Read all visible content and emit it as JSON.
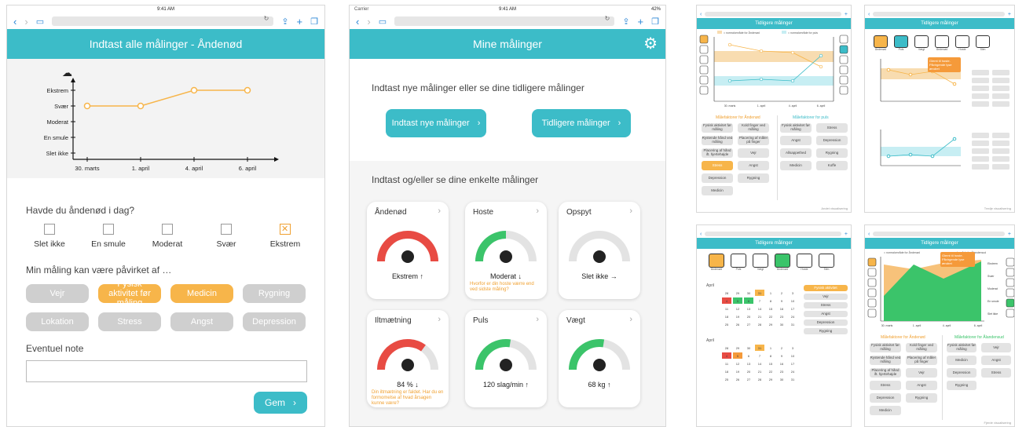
{
  "browser": {
    "time": "9:41 AM",
    "battery": "42%",
    "carrier": "Carrier"
  },
  "screen1": {
    "title": "Indtast alle målinger - Åndenød",
    "chart_data": {
      "type": "line",
      "categories": [
        "30. marts",
        "1. april",
        "4. april",
        "6. april"
      ],
      "y_levels": [
        "Slet ikke",
        "En smule",
        "Moderat",
        "Svær",
        "Ekstrem"
      ],
      "values": [
        3,
        3,
        4,
        4
      ],
      "color": "#f7b54a"
    },
    "question": "Havde du åndenød i dag?",
    "options": [
      "Slet ikke",
      "En smule",
      "Moderat",
      "Svær",
      "Ekstrem"
    ],
    "selected_option": "Ekstrem",
    "influence_label": "Min måling kan være påvirket af …",
    "tags": [
      {
        "label": "Vejr",
        "active": false
      },
      {
        "label": "Fysisk aktivitet før måling",
        "active": true
      },
      {
        "label": "Medicin",
        "active": true
      },
      {
        "label": "Rygning",
        "active": false
      },
      {
        "label": "Lokation",
        "active": false
      },
      {
        "label": "Stress",
        "active": false
      },
      {
        "label": "Angst",
        "active": false
      },
      {
        "label": "Depression",
        "active": false
      }
    ],
    "note_label": "Eventuel note",
    "save_label": "Gem",
    "save_arrow": "›"
  },
  "screen2": {
    "title": "Mine målinger",
    "intro": "Indtast nye målinger eller se dine tidligere målinger",
    "btn_new": "Indtast nye målinger",
    "btn_prev": "Tidligere målinger",
    "section": "Indtast og/eller se dine enkelte målinger",
    "cards": [
      {
        "title": "Åndenød",
        "value": "Ekstrem ↑",
        "warn": "",
        "level": 1.0,
        "color": "#e84b43"
      },
      {
        "title": "Hoste",
        "value": "Moderat ↓",
        "warn": "Hvorfor er din hoste værre end ved sidste måling?",
        "level": 0.5,
        "color": "#3bc46a"
      },
      {
        "title": "Opspyt",
        "value": "Slet ikke →",
        "warn": "",
        "level": 0.0,
        "color": "#3bc46a"
      },
      {
        "title": "Iltmætning",
        "value": "84 % ↓",
        "warn": "Din iltmætning er faldet. Har du en formomelse af hvad årsagen kunne være?",
        "level": 0.7,
        "color": "#e84b43"
      },
      {
        "title": "Puls",
        "value": "120 slag/min ↑",
        "warn": "",
        "level": 0.55,
        "color": "#3bc46a"
      },
      {
        "title": "Vægt",
        "value": "68 kg ↑",
        "warn": "",
        "level": 0.55,
        "color": "#3bc46a"
      }
    ]
  },
  "screen3": {
    "title": "Tidligere målinger",
    "legend1": "= normalområde for Åndenød",
    "legend2": "= normalområde for puls",
    "dates": [
      "30. marts",
      "1. april",
      "4. april",
      "6. april"
    ],
    "panel1": "Målefaktorer for Åndenød",
    "panel2": "Målefaktorer for puls",
    "factors1": [
      "Fysisk aktivitet før måling",
      "Kold finger ved måling",
      "Rystende hånd ved måling",
      "Placering af måler på finger",
      "Placering af hånd ift. hjertehøjde",
      "Vejr",
      "Stress",
      "Angst",
      "Depression",
      "Rygning",
      "Medicin"
    ],
    "factors2": [
      "Fysisk aktivitet før måling",
      "Stress",
      "Angst",
      "Depression",
      "Allsappethed",
      "Rygning",
      "Medicin",
      "Koffe"
    ],
    "footer": "Andet visualisering"
  },
  "screen4": {
    "title": "Tidligere målinger",
    "tiles": [
      "Åndenød",
      "Puls",
      "Vægt",
      "Åndenød",
      "Hoste",
      "Slim"
    ],
    "tooltip": "Glemt til hoste. Påvirgende lyse ændret",
    "footer": "Tredje visualisering"
  },
  "screen5": {
    "title": "Tidligere målinger",
    "tiles": [
      "Åndenød",
      "Puls",
      "Vægt",
      "Åndenød",
      "Hoste",
      "Slim"
    ],
    "month1": "April",
    "month2": "April",
    "weekdays": [
      "M",
      "T",
      "O",
      "T",
      "F",
      "L",
      "S"
    ]
  },
  "screen6": {
    "title": "Tidligere målinger",
    "legend1": "= normalområde for Åndenød",
    "legend2": "= normalområde for Ålandensud",
    "tooltip": "Glemt til hoste. Påvirgende lyse ændret",
    "y_levels": [
      "Ekstrem",
      "Svær",
      "Moderat",
      "En smule",
      "Slet ikke"
    ],
    "dates": [
      "30. marts",
      "1. april",
      "4. april",
      "6. april"
    ],
    "panel1": "Målefaktorer for Åndenød",
    "panel2": "Målefaktorer for Ålandensud",
    "factors1": [
      "Fysisk aktivitet før måling",
      "Kold finger ved måling",
      "Rystende hånd ved måling",
      "Placering af måler på finger",
      "Placering af hånd ift. hjertehøjde",
      "Vejr",
      "Stress",
      "Angst",
      "Depression",
      "Rygning",
      "Medicin"
    ],
    "factors2": [
      "Fysisk aktivitet før måling",
      "Vejr",
      "Medicin",
      "Angst",
      "Depression",
      "Stress",
      "Rygning"
    ],
    "footer": "Fjerde visualisering"
  }
}
